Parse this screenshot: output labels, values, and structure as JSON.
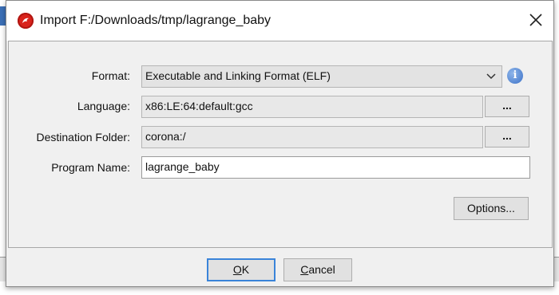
{
  "window": {
    "title": "Import F:/Downloads/tmp/lagrange_baby",
    "icon": "ghidra-dragon-icon",
    "close": "close-icon"
  },
  "form": {
    "format": {
      "label": "Format:",
      "value": "Executable and Linking Format (ELF)"
    },
    "language": {
      "label": "Language:",
      "value": "x86:LE:64:default:gcc",
      "browse": "..."
    },
    "destination": {
      "label": "Destination Folder:",
      "value": "corona:/",
      "browse": "..."
    },
    "program_name": {
      "label": "Program Name:",
      "value": "lagrange_baby"
    }
  },
  "buttons": {
    "options": "Options...",
    "ok_first": "O",
    "ok_rest": "K",
    "cancel_first": "C",
    "cancel_rest": "ancel"
  },
  "colors": {
    "accent": "#3a84d9",
    "icon_red": "#d9231c",
    "info_blue": "#3c72c8"
  }
}
